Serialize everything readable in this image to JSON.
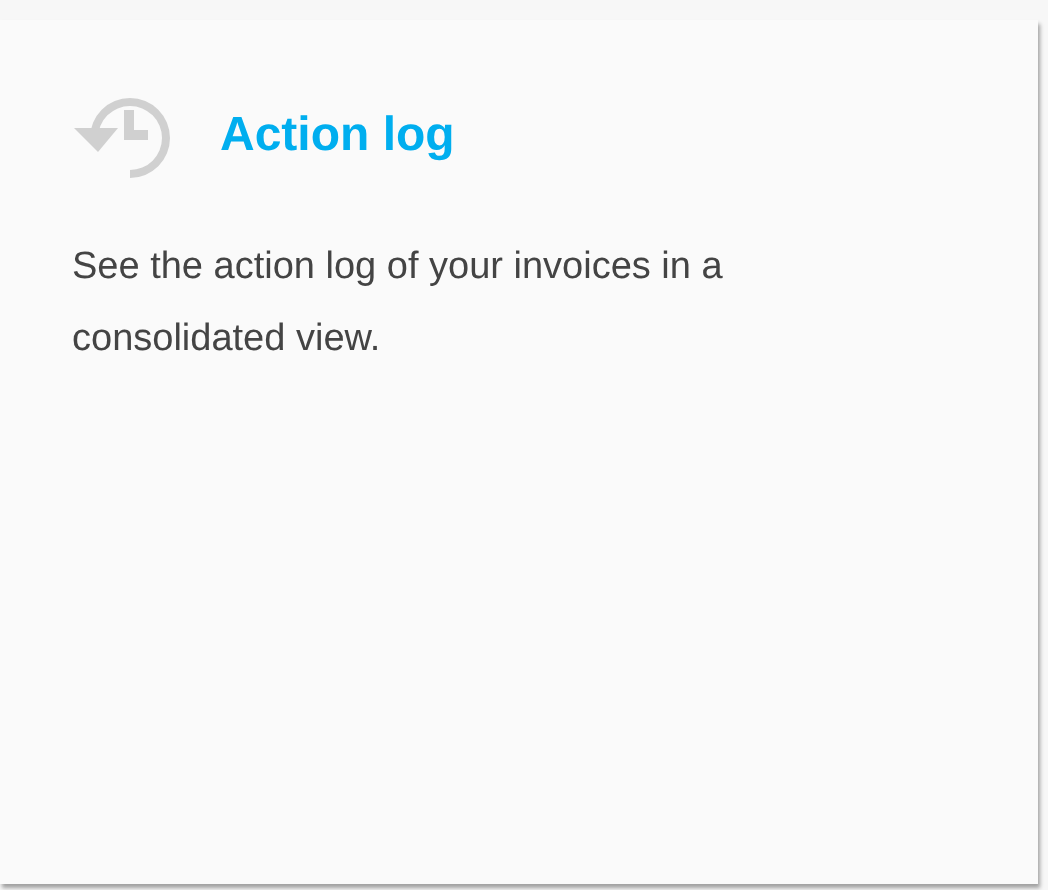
{
  "card": {
    "title": "Action log",
    "description": "See the action log of your invoices in a consolidated view."
  }
}
